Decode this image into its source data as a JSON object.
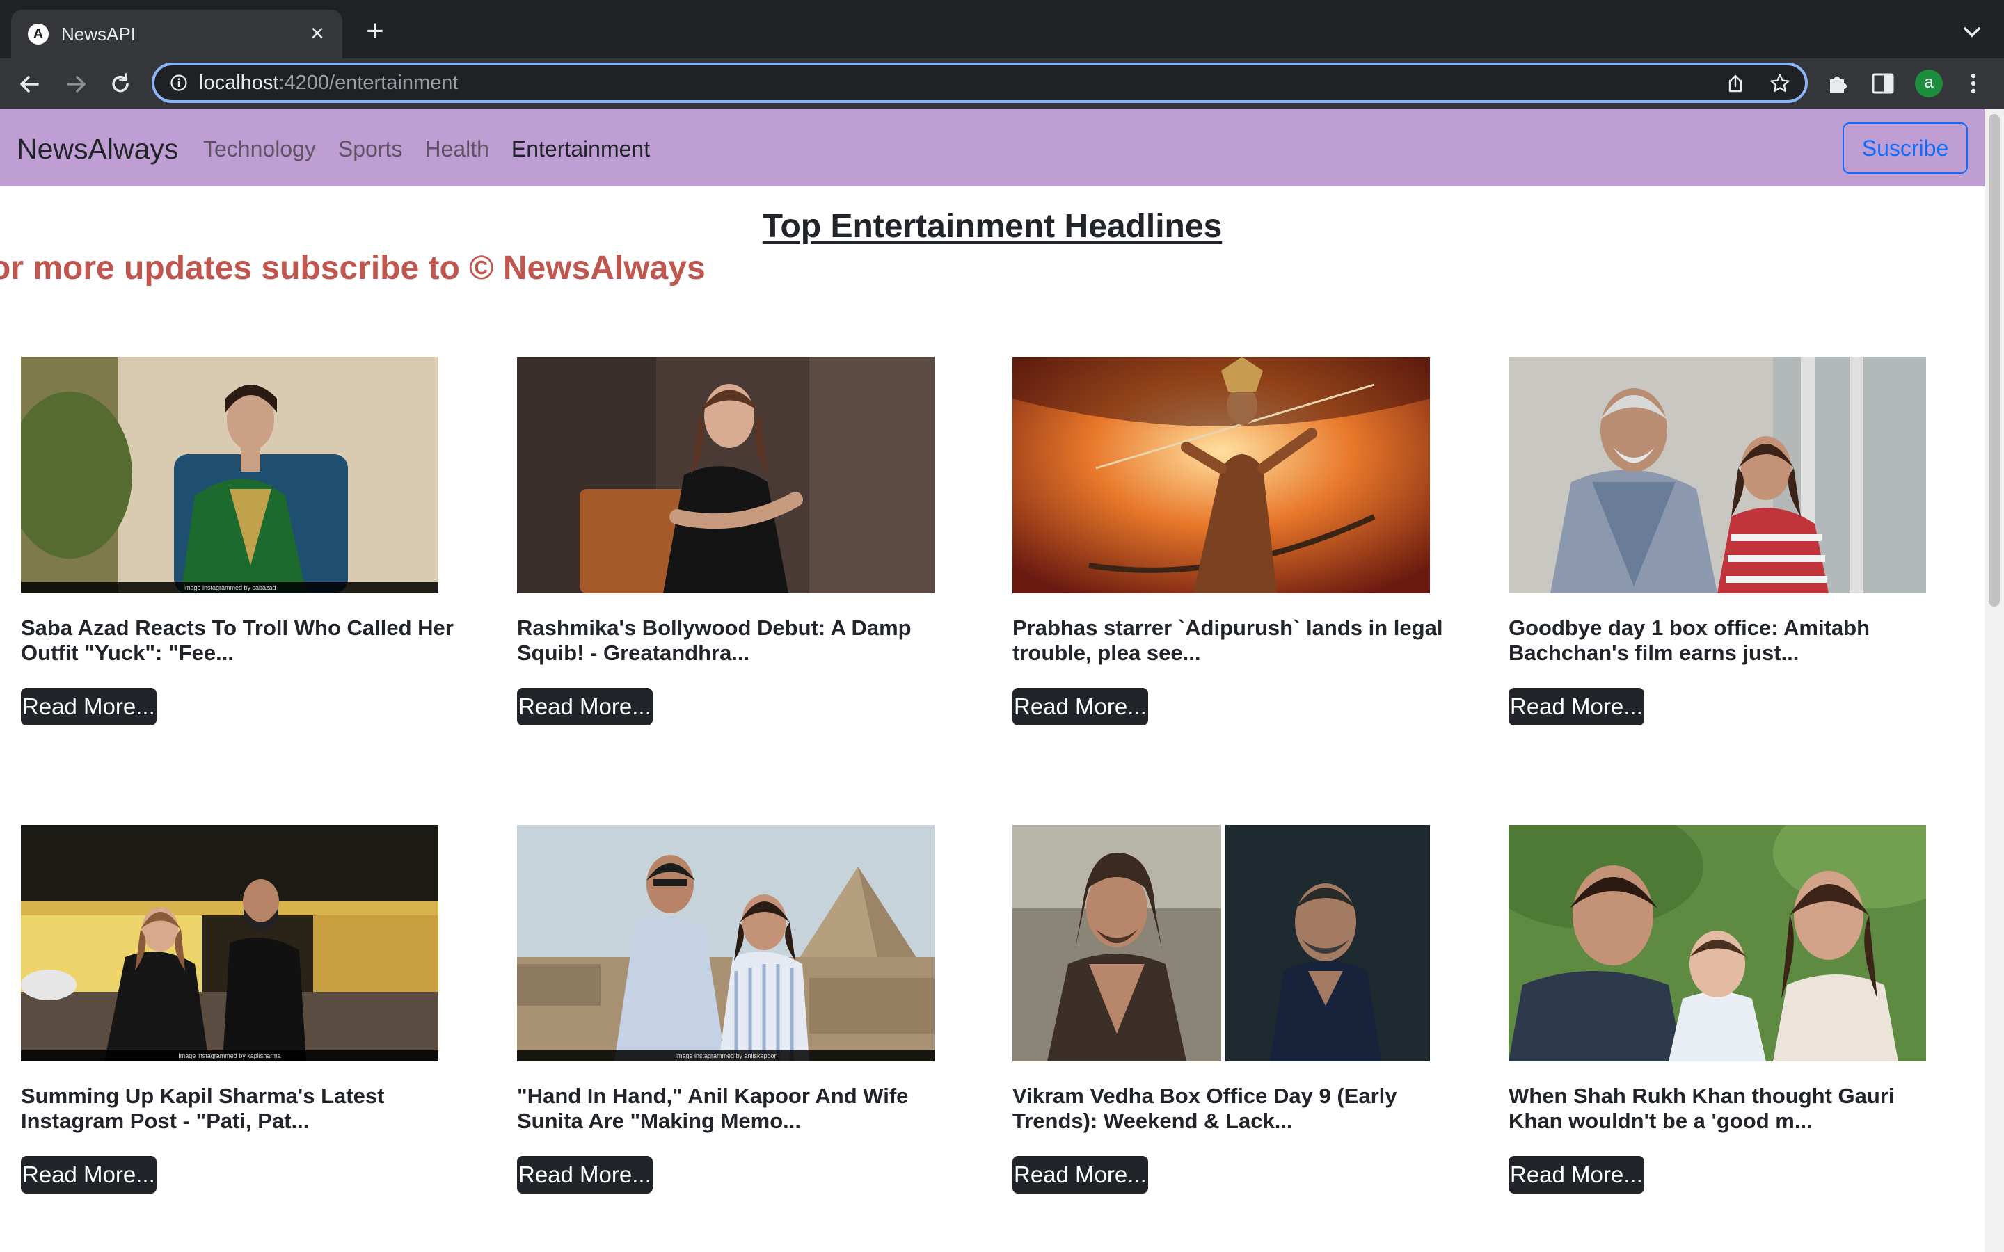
{
  "browser": {
    "tab_title": "NewsAPI",
    "tab_favicon": "A",
    "url_host": "localhost",
    "url_path": ":4200/entertainment",
    "profile_initial": "a"
  },
  "navbar": {
    "brand": "NewsAlways",
    "links": [
      "Technology",
      "Sports",
      "Health",
      "Entertainment"
    ],
    "active_link": "Entertainment",
    "subscribe_label": "Suscribe",
    "background": "#bf9ed3"
  },
  "page": {
    "heading": "Top Entertainment Headlines",
    "marquee": "or more updates subscribe to © NewsAlways",
    "read_more_label": "Read More..."
  },
  "articles": [
    {
      "title": "Saba Azad Reacts To Troll Who Called Her Outfit \"Yuck\": \"Fee...",
      "image_caption": "Image instagrammed by sabazad"
    },
    {
      "title": "Rashmika's Bollywood Debut: A Damp Squib! - Greatandhra...",
      "image_caption": ""
    },
    {
      "title": "Prabhas starrer `Adipurush` lands in legal trouble, plea see...",
      "image_caption": ""
    },
    {
      "title": "Goodbye day 1 box office: Amitabh Bachchan's film earns just...",
      "image_caption": ""
    },
    {
      "title": "Summing Up Kapil Sharma's Latest Instagram Post - \"Pati, Pat...",
      "image_caption": "Image instagrammed by kapilsharma"
    },
    {
      "title": "\"Hand In Hand,\" Anil Kapoor And Wife Sunita Are \"Making Memo...",
      "image_caption": "Image instagrammed by anilskapoor"
    },
    {
      "title": "Vikram Vedha Box Office Day 9 (Early Trends): Weekend & Lack...",
      "image_caption": ""
    },
    {
      "title": "When Shah Rukh Khan thought Gauri Khan wouldn't be a 'good m...",
      "image_caption": ""
    }
  ]
}
